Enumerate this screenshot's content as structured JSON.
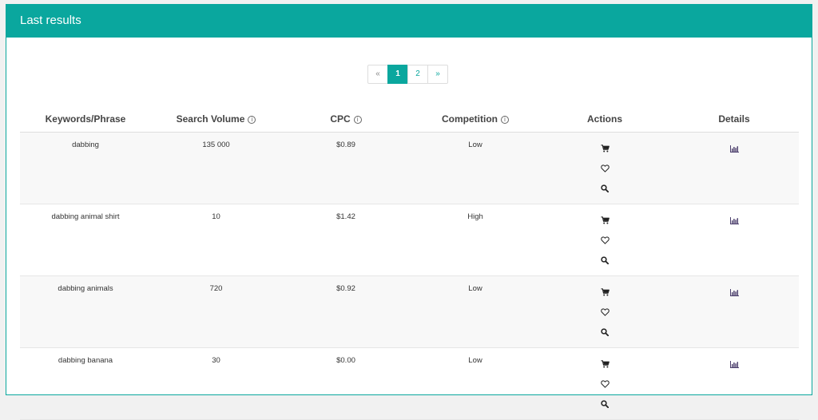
{
  "panel": {
    "title": "Last results"
  },
  "pagination": {
    "prev": "«",
    "pages": [
      "1",
      "2"
    ],
    "next": "»",
    "active": "1"
  },
  "table": {
    "headers": {
      "keyword": "Keywords/Phrase",
      "volume": "Search Volume",
      "cpc": "CPC",
      "competition": "Competition",
      "actions": "Actions",
      "details": "Details"
    },
    "info_glyph": "i",
    "rows": [
      {
        "keyword": "dabbing",
        "volume": "135 000",
        "cpc": "$0.89",
        "competition": "Low"
      },
      {
        "keyword": "dabbing animal shirt",
        "volume": "10",
        "cpc": "$1.42",
        "competition": "High"
      },
      {
        "keyword": "dabbing animals",
        "volume": "720",
        "cpc": "$0.92",
        "competition": "Low"
      },
      {
        "keyword": "dabbing banana",
        "volume": "30",
        "cpc": "$0.00",
        "competition": "Low"
      }
    ]
  },
  "icons": {
    "cart": "cart-icon",
    "heart": "heart-icon",
    "search": "search-icon",
    "details": "bar-chart-icon"
  },
  "colors": {
    "accent": "#0aa79e",
    "text": "#333333",
    "stripe": "#f8f8f8"
  }
}
